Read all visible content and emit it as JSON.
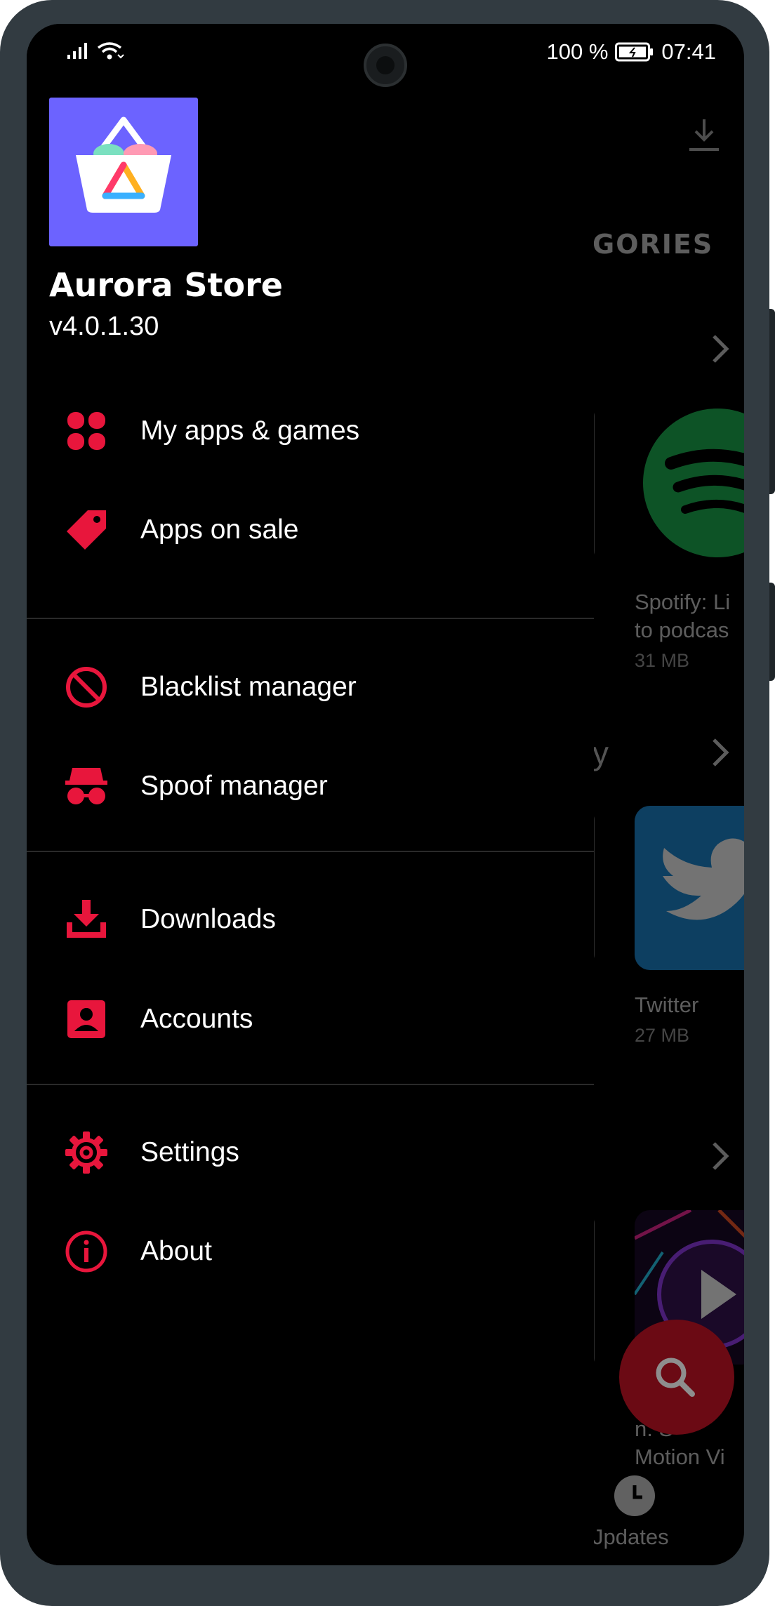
{
  "status_bar": {
    "battery": "100 %",
    "time": "07:41"
  },
  "drawer": {
    "app_name": "Aurora Store",
    "version": "v4.0.1.30",
    "groups": [
      [
        {
          "label": "My apps & games",
          "icon": "apps-grid-icon"
        },
        {
          "label": "Apps on sale",
          "icon": "sale-tag-icon"
        }
      ],
      [
        {
          "label": "Blacklist manager",
          "icon": "block-icon"
        },
        {
          "label": "Spoof manager",
          "icon": "spy-icon"
        }
      ],
      [
        {
          "label": "Downloads",
          "icon": "download-tray-icon"
        },
        {
          "label": "Accounts",
          "icon": "account-box-icon"
        }
      ],
      [
        {
          "label": "Settings",
          "icon": "gear-icon"
        },
        {
          "label": "About",
          "icon": "info-icon"
        }
      ]
    ]
  },
  "background": {
    "section_header": "GORIES",
    "letter": "y",
    "apps": [
      {
        "name_line1": "Spotify: Li",
        "name_line2": "to podcas",
        "size": "31 MB"
      },
      {
        "name_line1": "Twitter",
        "size": "27 MB"
      },
      {
        "name_line1": "n: S",
        "name_line2": "Motion Vi"
      }
    ],
    "bottom_tab": "Jpdates"
  },
  "colors": {
    "accent": "#e8163c",
    "logo_bg": "#6c63ff",
    "fab": "#6b0a14"
  }
}
